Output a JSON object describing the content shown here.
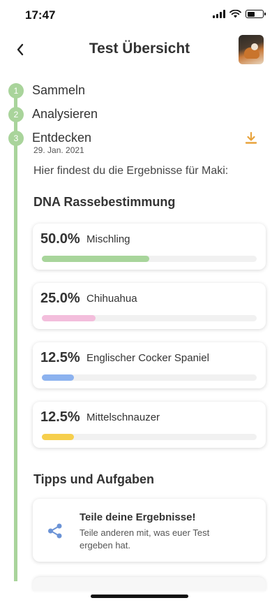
{
  "status": {
    "time": "17:47"
  },
  "header": {
    "title": "Test Übersicht",
    "back_icon": "chevron-left-icon"
  },
  "steps": [
    {
      "number": "1",
      "label": "Sammeln"
    },
    {
      "number": "2",
      "label": "Analysieren"
    },
    {
      "number": "3",
      "label": "Entdecken",
      "date": "29. Jan. 2021"
    }
  ],
  "intro": "Hier findest du die Ergebnisse für Maki:",
  "dna": {
    "title": "DNA Rassebestimmung",
    "breeds": [
      {
        "percent_label": "50.0%",
        "name": "Mischling",
        "fraction": 0.5,
        "color": "#a8d59b"
      },
      {
        "percent_label": "25.0%",
        "name": "Chihuahua",
        "fraction": 0.25,
        "color": "#f3bedc"
      },
      {
        "percent_label": "12.5%",
        "name": "Englischer Cocker Spaniel",
        "fraction": 0.15,
        "color": "#8cb2ef"
      },
      {
        "percent_label": "12.5%",
        "name": "Mittelschnauzer",
        "fraction": 0.15,
        "color": "#f6cf4d"
      }
    ]
  },
  "tips": {
    "title": "Tipps und Aufgaben",
    "items": [
      {
        "title": "Teile deine Ergebnisse!",
        "text": "Teile anderen mit, was euer Test ergeben hat.",
        "icon": "share-icon"
      }
    ]
  },
  "colors": {
    "accent_green": "#a9d49b",
    "download_orange": "#e8a33c",
    "share_blue": "#6b93d6"
  }
}
